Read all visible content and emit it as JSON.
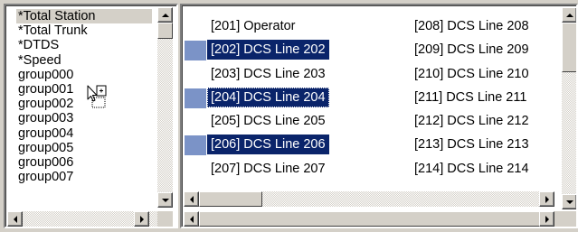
{
  "left_list": {
    "items": [
      {
        "label": "*Total Station",
        "selected": true
      },
      {
        "label": "*Total Trunk",
        "selected": false
      },
      {
        "label": "*DTDS",
        "selected": false
      },
      {
        "label": "*Speed",
        "selected": false
      },
      {
        "label": "group000",
        "selected": false
      },
      {
        "label": "group001",
        "selected": false
      },
      {
        "label": "group002",
        "selected": false
      },
      {
        "label": "group003",
        "selected": false
      },
      {
        "label": "group004",
        "selected": false
      },
      {
        "label": "group005",
        "selected": false
      },
      {
        "label": "group006",
        "selected": false
      },
      {
        "label": "group007",
        "selected": false
      }
    ]
  },
  "right_list": {
    "column1": [
      {
        "label": "[201] Operator",
        "selected": false
      },
      {
        "label": "[202] DCS Line 202",
        "selected": true
      },
      {
        "label": "[203] DCS Line 203",
        "selected": false
      },
      {
        "label": "[204] DCS Line 204",
        "selected": true,
        "focused": true
      },
      {
        "label": "[205] DCS Line 205",
        "selected": false
      },
      {
        "label": "[206] DCS Line 206",
        "selected": true
      },
      {
        "label": "[207] DCS Line 207",
        "selected": false
      }
    ],
    "column2": [
      {
        "label": "[208] DCS Line 208"
      },
      {
        "label": "[209] DCS Line 209"
      },
      {
        "label": "[210] DCS Line 210"
      },
      {
        "label": "[211] DCS Line 211"
      },
      {
        "label": "[212] DCS Line 212"
      },
      {
        "label": "[213] DCS Line 213"
      },
      {
        "label": "[214] DCS Line 214"
      }
    ]
  },
  "cursor": {
    "icon": "drag-copy-cursor-icon"
  },
  "colors": {
    "selection": "#0a246a",
    "selection_marker": "#7b93c7",
    "face": "#d4d0c8"
  }
}
